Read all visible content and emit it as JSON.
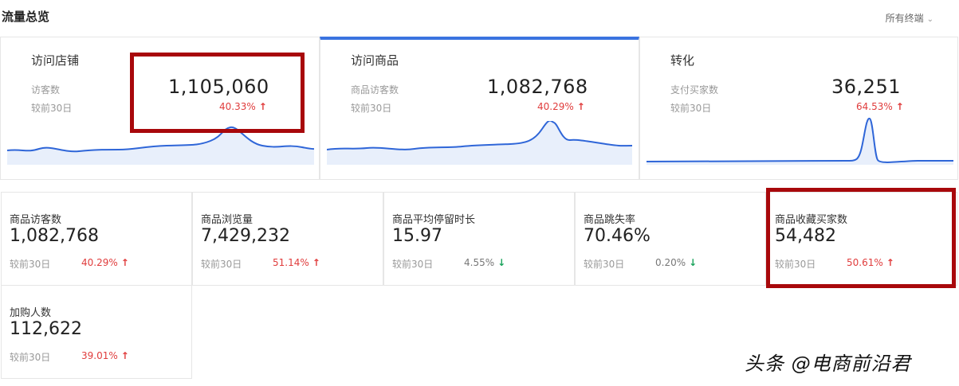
{
  "header": {
    "title": "流量总览",
    "terminal_select": "所有终端",
    "caret_icon": "chevron-down-icon"
  },
  "cards": [
    {
      "title": "访问店铺",
      "metric_label": "访客数",
      "value": "1,105,060",
      "compare_label": "较前30日",
      "compare_value": "40.33%",
      "trend": "up",
      "active": false
    },
    {
      "title": "访问商品",
      "metric_label": "商品访客数",
      "value": "1,082,768",
      "compare_label": "较前30日",
      "compare_value": "40.29%",
      "trend": "up",
      "active": true
    },
    {
      "title": "转化",
      "metric_label": "支付买家数",
      "value": "36,251",
      "compare_label": "较前30日",
      "compare_value": "64.53%",
      "trend": "up",
      "active": false
    }
  ],
  "stats": [
    {
      "title": "商品访客数",
      "value": "1,082,768",
      "compare_label": "较前30日",
      "compare_value": "40.29%",
      "trend": "up"
    },
    {
      "title": "商品浏览量",
      "value": "7,429,232",
      "compare_label": "较前30日",
      "compare_value": "51.14%",
      "trend": "up"
    },
    {
      "title": "商品平均停留时长",
      "value": "15.97",
      "compare_label": "较前30日",
      "compare_value": "4.55%",
      "trend": "down"
    },
    {
      "title": "商品跳失率",
      "value": "70.46%",
      "compare_label": "较前30日",
      "compare_value": "0.20%",
      "trend": "down"
    },
    {
      "title": "商品收藏买家数",
      "value": "54,482",
      "compare_label": "较前30日",
      "compare_value": "50.61%",
      "trend": "up"
    },
    {
      "title": "加购人数",
      "value": "112,622",
      "compare_label": "较前30日",
      "compare_value": "39.01%",
      "trend": "up"
    }
  ],
  "icons": {
    "up": "↑",
    "down": "↓"
  },
  "colors": {
    "accent": "#3a73e0",
    "up": "#e03c3c",
    "down": "#1aa35c",
    "highlight": "#a8080b",
    "sparkline_fill": "#e8effb"
  },
  "watermark": "头条 @电商前沿君"
}
